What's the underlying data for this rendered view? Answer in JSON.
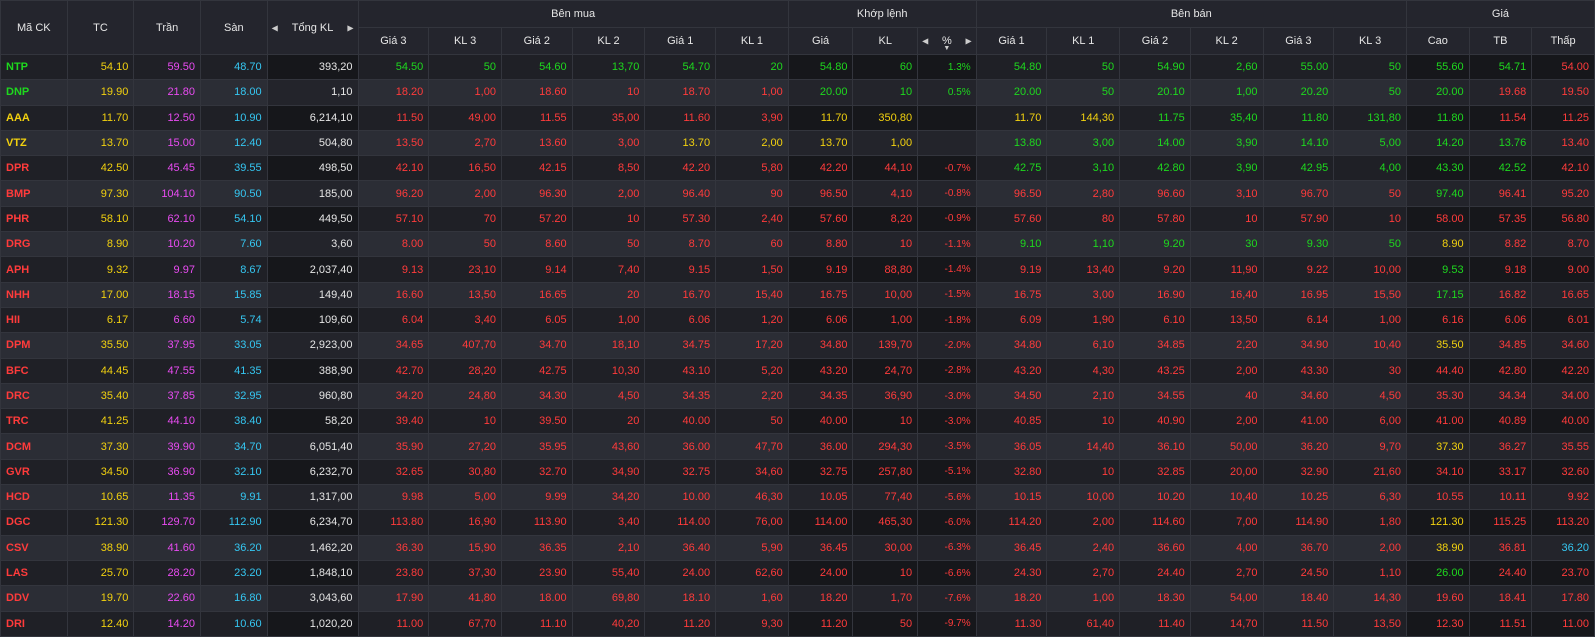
{
  "headers": {
    "symbol": "Mã CK",
    "ref": "TC",
    "ceil": "Trần",
    "floor": "Sàn",
    "total_vol": "Tổng KL",
    "buy_group": "Bên mua",
    "match_group": "Khớp lệnh",
    "sell_group": "Bên bán",
    "price_group": "Giá",
    "buy_cols": [
      "Giá 3",
      "KL 3",
      "Giá 2",
      "KL 2",
      "Giá 1",
      "KL 1"
    ],
    "match_cols": [
      "Giá",
      "KL",
      "%"
    ],
    "sell_cols": [
      "Giá 1",
      "KL 1",
      "Giá 2",
      "KL 2",
      "Giá 3",
      "KL 3"
    ],
    "price_cols": [
      "Cao",
      "TB",
      "Thấp"
    ]
  },
  "colors": {
    "up": "#1ed81e",
    "down": "#ff3b3b",
    "ref": "#f2d10f",
    "ceil": "#e94bf2",
    "floor": "#35c7f2"
  },
  "rows": [
    {
      "sym": "NTP",
      "ref": "54.10",
      "ceil": "59.50",
      "floor": "48.70",
      "tot": "393,20",
      "b3p": "54.50",
      "b3v": "50",
      "b2p": "54.60",
      "b2v": "13,70",
      "b1p": "54.70",
      "b1v": "20",
      "mp": "54.80",
      "mv": "60",
      "pct": "1.3%",
      "s1p": "54.80",
      "s1v": "50",
      "s2p": "54.90",
      "s2v": "2,60",
      "s3p": "55.00",
      "s3v": "50",
      "hi": "55.60",
      "avg": "54.71",
      "lo": "54.00"
    },
    {
      "sym": "DNP",
      "ref": "19.90",
      "ceil": "21.80",
      "floor": "18.00",
      "tot": "1,10",
      "b3p": "18.20",
      "b3v": "1,00",
      "b2p": "18.60",
      "b2v": "10",
      "b1p": "18.70",
      "b1v": "1,00",
      "mp": "20.00",
      "mv": "10",
      "pct": "0.5%",
      "s1p": "20.00",
      "s1v": "50",
      "s2p": "20.10",
      "s2v": "1,00",
      "s3p": "20.20",
      "s3v": "50",
      "hi": "20.00",
      "avg": "19.68",
      "lo": "19.50"
    },
    {
      "sym": "AAA",
      "ref": "11.70",
      "ceil": "12.50",
      "floor": "10.90",
      "tot": "6,214,10",
      "b3p": "11.50",
      "b3v": "49,00",
      "b2p": "11.55",
      "b2v": "35,00",
      "b1p": "11.60",
      "b1v": "3,90",
      "mp": "11.70",
      "mv": "350,80",
      "pct": "",
      "s1p": "11.70",
      "s1v": "144,30",
      "s2p": "11.75",
      "s2v": "35,40",
      "s3p": "11.80",
      "s3v": "131,80",
      "hi": "11.80",
      "avg": "11.54",
      "lo": "11.25"
    },
    {
      "sym": "VTZ",
      "ref": "13.70",
      "ceil": "15.00",
      "floor": "12.40",
      "tot": "504,80",
      "b3p": "13.50",
      "b3v": "2,70",
      "b2p": "13.60",
      "b2v": "3,00",
      "b1p": "13.70",
      "b1v": "2,00",
      "mp": "13.70",
      "mv": "1,00",
      "pct": "",
      "s1p": "13.80",
      "s1v": "3,00",
      "s2p": "14.00",
      "s2v": "3,90",
      "s3p": "14.10",
      "s3v": "5,00",
      "hi": "14.20",
      "avg": "13.76",
      "lo": "13.40"
    },
    {
      "sym": "DPR",
      "ref": "42.50",
      "ceil": "45.45",
      "floor": "39.55",
      "tot": "498,50",
      "b3p": "42.10",
      "b3v": "16,50",
      "b2p": "42.15",
      "b2v": "8,50",
      "b1p": "42.20",
      "b1v": "5,80",
      "mp": "42.20",
      "mv": "44,10",
      "pct": "-0.7%",
      "s1p": "42.75",
      "s1v": "3,10",
      "s2p": "42.80",
      "s2v": "3,90",
      "s3p": "42.95",
      "s3v": "4,00",
      "hi": "43.30",
      "avg": "42.52",
      "lo": "42.10"
    },
    {
      "sym": "BMP",
      "ref": "97.30",
      "ceil": "104.10",
      "floor": "90.50",
      "tot": "185,00",
      "b3p": "96.20",
      "b3v": "2,00",
      "b2p": "96.30",
      "b2v": "2,00",
      "b1p": "96.40",
      "b1v": "90",
      "mp": "96.50",
      "mv": "4,10",
      "pct": "-0.8%",
      "s1p": "96.50",
      "s1v": "2,80",
      "s2p": "96.60",
      "s2v": "3,10",
      "s3p": "96.70",
      "s3v": "50",
      "hi": "97.40",
      "avg": "96.41",
      "lo": "95.20"
    },
    {
      "sym": "PHR",
      "ref": "58.10",
      "ceil": "62.10",
      "floor": "54.10",
      "tot": "449,50",
      "b3p": "57.10",
      "b3v": "70",
      "b2p": "57.20",
      "b2v": "10",
      "b1p": "57.30",
      "b1v": "2,40",
      "mp": "57.60",
      "mv": "8,20",
      "pct": "-0.9%",
      "s1p": "57.60",
      "s1v": "80",
      "s2p": "57.80",
      "s2v": "10",
      "s3p": "57.90",
      "s3v": "10",
      "hi": "58.00",
      "avg": "57.35",
      "lo": "56.80"
    },
    {
      "sym": "DRG",
      "ref": "8.90",
      "ceil": "10.20",
      "floor": "7.60",
      "tot": "3,60",
      "b3p": "8.00",
      "b3v": "50",
      "b2p": "8.60",
      "b2v": "50",
      "b1p": "8.70",
      "b1v": "60",
      "mp": "8.80",
      "mv": "10",
      "pct": "-1.1%",
      "s1p": "9.10",
      "s1v": "1,10",
      "s2p": "9.20",
      "s2v": "30",
      "s3p": "9.30",
      "s3v": "50",
      "hi": "8.90",
      "avg": "8.82",
      "lo": "8.70"
    },
    {
      "sym": "APH",
      "ref": "9.32",
      "ceil": "9.97",
      "floor": "8.67",
      "tot": "2,037,40",
      "b3p": "9.13",
      "b3v": "23,10",
      "b2p": "9.14",
      "b2v": "7,40",
      "b1p": "9.15",
      "b1v": "1,50",
      "mp": "9.19",
      "mv": "88,80",
      "pct": "-1.4%",
      "s1p": "9.19",
      "s1v": "13,40",
      "s2p": "9.20",
      "s2v": "11,90",
      "s3p": "9.22",
      "s3v": "10,00",
      "hi": "9.53",
      "avg": "9.18",
      "lo": "9.00"
    },
    {
      "sym": "NHH",
      "ref": "17.00",
      "ceil": "18.15",
      "floor": "15.85",
      "tot": "149,40",
      "b3p": "16.60",
      "b3v": "13,50",
      "b2p": "16.65",
      "b2v": "20",
      "b1p": "16.70",
      "b1v": "15,40",
      "mp": "16.75",
      "mv": "10,00",
      "pct": "-1.5%",
      "s1p": "16.75",
      "s1v": "3,00",
      "s2p": "16.90",
      "s2v": "16,40",
      "s3p": "16.95",
      "s3v": "15,50",
      "hi": "17.15",
      "avg": "16.82",
      "lo": "16.65"
    },
    {
      "sym": "HII",
      "ref": "6.17",
      "ceil": "6.60",
      "floor": "5.74",
      "tot": "109,60",
      "b3p": "6.04",
      "b3v": "3,40",
      "b2p": "6.05",
      "b2v": "1,00",
      "b1p": "6.06",
      "b1v": "1,20",
      "mp": "6.06",
      "mv": "1,00",
      "pct": "-1.8%",
      "s1p": "6.09",
      "s1v": "1,90",
      "s2p": "6.10",
      "s2v": "13,50",
      "s3p": "6.14",
      "s3v": "1,00",
      "hi": "6.16",
      "avg": "6.06",
      "lo": "6.01"
    },
    {
      "sym": "DPM",
      "ref": "35.50",
      "ceil": "37.95",
      "floor": "33.05",
      "tot": "2,923,00",
      "b3p": "34.65",
      "b3v": "407,70",
      "b2p": "34.70",
      "b2v": "18,10",
      "b1p": "34.75",
      "b1v": "17,20",
      "mp": "34.80",
      "mv": "139,70",
      "pct": "-2.0%",
      "s1p": "34.80",
      "s1v": "6,10",
      "s2p": "34.85",
      "s2v": "2,20",
      "s3p": "34.90",
      "s3v": "10,40",
      "hi": "35.50",
      "avg": "34.85",
      "lo": "34.60"
    },
    {
      "sym": "BFC",
      "ref": "44.45",
      "ceil": "47.55",
      "floor": "41.35",
      "tot": "388,90",
      "b3p": "42.70",
      "b3v": "28,20",
      "b2p": "42.75",
      "b2v": "10,30",
      "b1p": "43.10",
      "b1v": "5,20",
      "mp": "43.20",
      "mv": "24,70",
      "pct": "-2.8%",
      "s1p": "43.20",
      "s1v": "4,30",
      "s2p": "43.25",
      "s2v": "2,00",
      "s3p": "43.30",
      "s3v": "30",
      "hi": "44.40",
      "avg": "42.80",
      "lo": "42.20"
    },
    {
      "sym": "DRC",
      "ref": "35.40",
      "ceil": "37.85",
      "floor": "32.95",
      "tot": "960,80",
      "b3p": "34.20",
      "b3v": "24,80",
      "b2p": "34.30",
      "b2v": "4,50",
      "b1p": "34.35",
      "b1v": "2,20",
      "mp": "34.35",
      "mv": "36,90",
      "pct": "-3.0%",
      "s1p": "34.50",
      "s1v": "2,10",
      "s2p": "34.55",
      "s2v": "40",
      "s3p": "34.60",
      "s3v": "4,50",
      "hi": "35.30",
      "avg": "34.34",
      "lo": "34.00"
    },
    {
      "sym": "TRC",
      "ref": "41.25",
      "ceil": "44.10",
      "floor": "38.40",
      "tot": "58,20",
      "b3p": "39.40",
      "b3v": "10",
      "b2p": "39.50",
      "b2v": "20",
      "b1p": "40.00",
      "b1v": "50",
      "mp": "40.00",
      "mv": "10",
      "pct": "-3.0%",
      "s1p": "40.85",
      "s1v": "10",
      "s2p": "40.90",
      "s2v": "2,00",
      "s3p": "41.00",
      "s3v": "6,00",
      "hi": "41.00",
      "avg": "40.89",
      "lo": "40.00"
    },
    {
      "sym": "DCM",
      "ref": "37.30",
      "ceil": "39.90",
      "floor": "34.70",
      "tot": "6,051,40",
      "b3p": "35.90",
      "b3v": "27,20",
      "b2p": "35.95",
      "b2v": "43,60",
      "b1p": "36.00",
      "b1v": "47,70",
      "mp": "36.00",
      "mv": "294,30",
      "pct": "-3.5%",
      "s1p": "36.05",
      "s1v": "14,40",
      "s2p": "36.10",
      "s2v": "50,00",
      "s3p": "36.20",
      "s3v": "9,70",
      "hi": "37.30",
      "avg": "36.27",
      "lo": "35.55"
    },
    {
      "sym": "GVR",
      "ref": "34.50",
      "ceil": "36.90",
      "floor": "32.10",
      "tot": "6,232,70",
      "b3p": "32.65",
      "b3v": "30,80",
      "b2p": "32.70",
      "b2v": "34,90",
      "b1p": "32.75",
      "b1v": "34,60",
      "mp": "32.75",
      "mv": "257,80",
      "pct": "-5.1%",
      "s1p": "32.80",
      "s1v": "10",
      "s2p": "32.85",
      "s2v": "20,00",
      "s3p": "32.90",
      "s3v": "21,60",
      "hi": "34.10",
      "avg": "33.17",
      "lo": "32.60"
    },
    {
      "sym": "HCD",
      "ref": "10.65",
      "ceil": "11.35",
      "floor": "9.91",
      "tot": "1,317,00",
      "b3p": "9.98",
      "b3v": "5,00",
      "b2p": "9.99",
      "b2v": "34,20",
      "b1p": "10.00",
      "b1v": "46,30",
      "mp": "10.05",
      "mv": "77,40",
      "pct": "-5.6%",
      "s1p": "10.15",
      "s1v": "10,00",
      "s2p": "10.20",
      "s2v": "10,40",
      "s3p": "10.25",
      "s3v": "6,30",
      "hi": "10.55",
      "avg": "10.11",
      "lo": "9.92"
    },
    {
      "sym": "DGC",
      "ref": "121.30",
      "ceil": "129.70",
      "floor": "112.90",
      "tot": "6,234,70",
      "b3p": "113.80",
      "b3v": "16,90",
      "b2p": "113.90",
      "b2v": "3,40",
      "b1p": "114.00",
      "b1v": "76,00",
      "mp": "114.00",
      "mv": "465,30",
      "pct": "-6.0%",
      "s1p": "114.20",
      "s1v": "2,00",
      "s2p": "114.60",
      "s2v": "7,00",
      "s3p": "114.90",
      "s3v": "1,80",
      "hi": "121.30",
      "avg": "115.25",
      "lo": "113.20"
    },
    {
      "sym": "CSV",
      "ref": "38.90",
      "ceil": "41.60",
      "floor": "36.20",
      "tot": "1,462,20",
      "b3p": "36.30",
      "b3v": "15,90",
      "b2p": "36.35",
      "b2v": "2,10",
      "b1p": "36.40",
      "b1v": "5,90",
      "mp": "36.45",
      "mv": "30,00",
      "pct": "-6.3%",
      "s1p": "36.45",
      "s1v": "2,40",
      "s2p": "36.60",
      "s2v": "4,00",
      "s3p": "36.70",
      "s3v": "2,00",
      "hi": "38.90",
      "avg": "36.81",
      "lo": "36.20"
    },
    {
      "sym": "LAS",
      "ref": "25.70",
      "ceil": "28.20",
      "floor": "23.20",
      "tot": "1,848,10",
      "b3p": "23.80",
      "b3v": "37,30",
      "b2p": "23.90",
      "b2v": "55,40",
      "b1p": "24.00",
      "b1v": "62,60",
      "mp": "24.00",
      "mv": "10",
      "pct": "-6.6%",
      "s1p": "24.30",
      "s1v": "2,70",
      "s2p": "24.40",
      "s2v": "2,70",
      "s3p": "24.50",
      "s3v": "1,10",
      "hi": "26.00",
      "avg": "24.40",
      "lo": "23.70"
    },
    {
      "sym": "DDV",
      "ref": "19.70",
      "ceil": "22.60",
      "floor": "16.80",
      "tot": "3,043,60",
      "b3p": "17.90",
      "b3v": "41,80",
      "b2p": "18.00",
      "b2v": "69,80",
      "b1p": "18.10",
      "b1v": "1,60",
      "mp": "18.20",
      "mv": "1,70",
      "pct": "-7.6%",
      "s1p": "18.20",
      "s1v": "1,00",
      "s2p": "18.30",
      "s2v": "54,00",
      "s3p": "18.40",
      "s3v": "14,30",
      "hi": "19.60",
      "avg": "18.41",
      "lo": "17.80"
    },
    {
      "sym": "DRI",
      "ref": "12.40",
      "ceil": "14.20",
      "floor": "10.60",
      "tot": "1,020,20",
      "b3p": "11.00",
      "b3v": "67,70",
      "b2p": "11.10",
      "b2v": "40,20",
      "b1p": "11.20",
      "b1v": "9,30",
      "mp": "11.20",
      "mv": "50",
      "pct": "-9.7%",
      "s1p": "11.30",
      "s1v": "61,40",
      "s2p": "11.40",
      "s2v": "14,70",
      "s3p": "11.50",
      "s3v": "13,50",
      "hi": "12.30",
      "avg": "11.51",
      "lo": "11.00"
    }
  ]
}
